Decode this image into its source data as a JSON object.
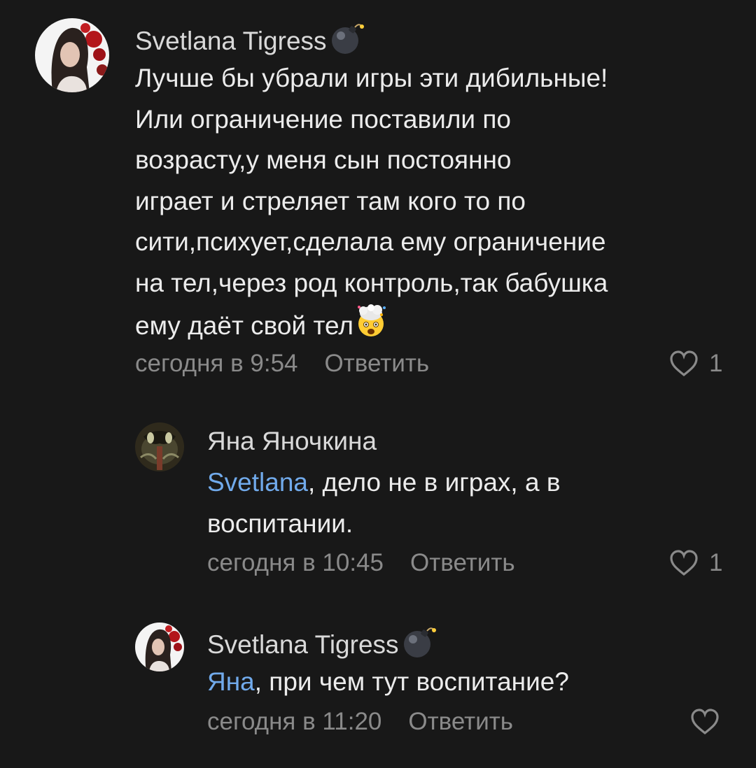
{
  "comments": [
    {
      "author": "Svetlana Tigress",
      "author_badge_icon": "bomb-icon",
      "text_lines": [
        "Лучше бы убрали игры эти дибильные!",
        "Или ограничение поставили по",
        "возрасту,у меня сын постоянно",
        "играет и стреляет там кого то по",
        "сити,психует,сделала ему ограничение",
        "на тел,через род контроль,так бабушка",
        "ему даёт свой тел"
      ],
      "trailing_emoji": "exploding-head-icon",
      "time": "сегодня в 9:54",
      "reply_label": "Ответить",
      "likes": "1"
    },
    {
      "author": "Яна Яночкина",
      "mention": "Svetlana",
      "text_rest_line1": ", дело не в играх, а в",
      "text_line2": "воспитании.",
      "time": "сегодня в 10:45",
      "reply_label": "Ответить",
      "likes": "1"
    },
    {
      "author": "Svetlana Tigress",
      "author_badge_icon": "bomb-icon",
      "mention": "Яна",
      "text_rest": ", при чем тут воспитание?",
      "time": "сегодня в 11:20",
      "reply_label": "Ответить",
      "likes": ""
    }
  ],
  "colors": {
    "background": "#181818",
    "text": "#ececec",
    "meta": "#8a8a8a",
    "mention": "#71aaeb"
  }
}
